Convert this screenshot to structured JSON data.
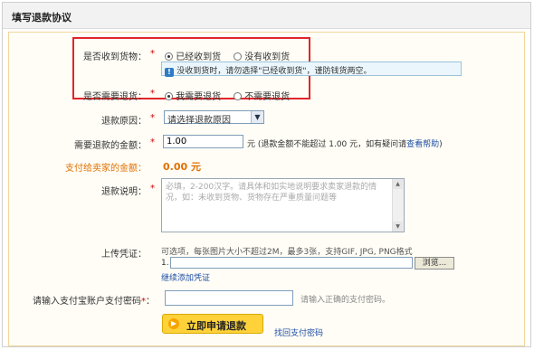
{
  "page_title": "填写退款协议",
  "received_goods": {
    "label": "是否收到货物：",
    "required_mark": "*",
    "options": [
      "已经收到货",
      "没有收到货"
    ],
    "selected_index": 0,
    "notice": "没收到货时，请勿选择\"已经收到货\"，谨防钱货两空。"
  },
  "return_goods": {
    "label": "是否需要退货：",
    "required_mark": "*",
    "options": [
      "我需要退货",
      "不需要退货"
    ],
    "selected_index": 0
  },
  "refund_reason": {
    "label": "退款原因：",
    "required_mark": "*",
    "selected": "请选择退款原因"
  },
  "refund_amount": {
    "label": "需要退款的金额：",
    "required_mark": "*",
    "value": "1.00",
    "hint_prefix": "元 (退款金额不能超过 1.00 元，如有疑问请",
    "help_link": "查看帮助",
    "hint_suffix": ")"
  },
  "seller_payment": {
    "label": "支付给卖家的金额：",
    "value": "0.00 元"
  },
  "refund_description": {
    "label": "退款说明：",
    "required_mark": "*",
    "placeholder": "必填，2-200汉字。请具体和如实地说明要求卖家退款的情况，如：未收到货物、货物存在严重质量问题等"
  },
  "upload": {
    "label": "上传凭证：",
    "hint": "可选项，每张图片大小不超过2M，最多3张，支持GIF, JPG, PNG格式",
    "index": "1.",
    "browse_label": "浏览...",
    "add_more_link": "继续添加凭证"
  },
  "password": {
    "label": "请输入支付宝账户支付密码",
    "required_mark": "*",
    "colon": "：",
    "hint": "请输入正确的支付密码。"
  },
  "submit": {
    "label": "立即申请退款",
    "icon": "arrow-right-icon"
  },
  "forgot_password_link": "找回支付密码",
  "colors": {
    "highlight_border": "#e0262b",
    "required": "#d40000",
    "orange_label": "#e07000",
    "link": "#1f4fa6",
    "button_yellow": "#ffd23a"
  }
}
